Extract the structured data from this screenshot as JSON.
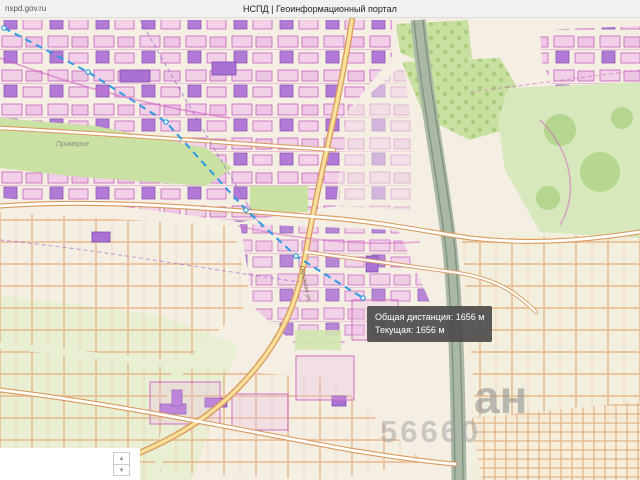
{
  "header": {
    "site_url": "nspd.gov.ru",
    "title": "НСПД | Геоинформационный портал"
  },
  "measure_tooltip": {
    "total": "Общая дистанция: 1656 м",
    "current": "Текущая: 1656 м"
  },
  "map": {
    "labels": {
      "district": "Приморье",
      "road": "Окружная ул."
    },
    "watermark": {
      "text_top": "ан",
      "text_bottom": "56660"
    }
  },
  "controls": {
    "stepper_up": "▴",
    "stepper_down": "▾"
  },
  "colors": {
    "measure_line": "#2e9be0",
    "tooltip_bg": "#4d4d4d",
    "parcel_pink": "#f1d0e8",
    "parcel_outline": "#c75fc0",
    "road_casing": "#d99a5c"
  }
}
